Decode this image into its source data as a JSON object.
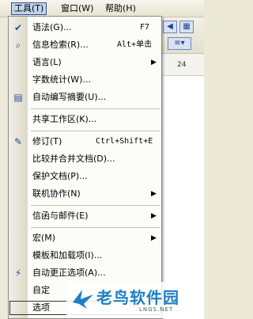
{
  "menubar": {
    "items": [
      {
        "label": "工具(T)"
      },
      {
        "label": "窗口(W)"
      },
      {
        "label": "帮助(H)"
      }
    ]
  },
  "background_app": {
    "ruler_number": "24"
  },
  "menu": {
    "items": [
      {
        "label": "语法(G)...",
        "shortcut": "F7",
        "icon": "abc-check-icon"
      },
      {
        "label": "信息检索(R)...",
        "shortcut": "Alt+单击",
        "icon": "research-icon"
      },
      {
        "label": "语言(L)",
        "icon": "",
        "submenu": true
      },
      {
        "label": "字数统计(W)...",
        "icon": ""
      },
      {
        "label": "自动编写摘要(U)...",
        "icon": "autosummarize-icon"
      },
      {
        "label": "共享工作区(K)...",
        "icon": ""
      },
      {
        "label": "修订(T)",
        "shortcut": "Ctrl+Shift+E",
        "icon": "track-changes-icon"
      },
      {
        "label": "比较并合并文档(D)...",
        "icon": ""
      },
      {
        "label": "保护文档(P)...",
        "icon": ""
      },
      {
        "label": "联机协作(N)",
        "icon": "",
        "submenu": true
      },
      {
        "label": "信函与邮件(E)",
        "icon": "",
        "submenu": true
      },
      {
        "label": "宏(M)",
        "icon": "",
        "submenu": true
      },
      {
        "label": "模板和加载项(I)...",
        "icon": ""
      },
      {
        "label": "自动更正选项(A)...",
        "icon": "autocorrect-icon"
      },
      {
        "label": "自定",
        "icon": ""
      },
      {
        "label": "选项",
        "icon": ""
      }
    ]
  },
  "watermark": {
    "title": "老鸟软件园",
    "subtitle": "LNGS.NET"
  }
}
